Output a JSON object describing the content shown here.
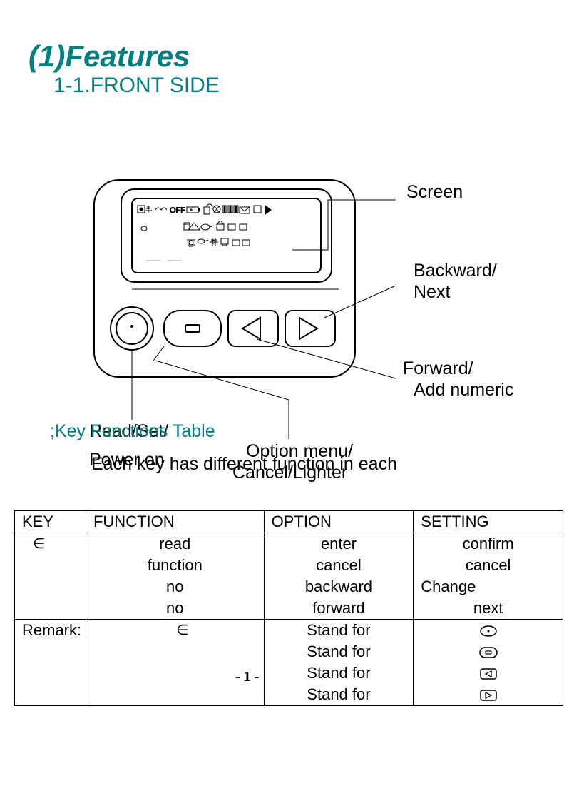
{
  "title": "(1)Features",
  "subtitle": "1-1.FRONT SIDE",
  "labels": {
    "screen": "Screen",
    "backward": "Backward/",
    "next": "Next",
    "forward": "Forward/",
    "addnumeric": "Add numeric",
    "readset": "Read/Set/",
    "poweron": "Power on",
    "optionmenu": "Option menu/",
    "cancellighter": "Cancel/Lighter"
  },
  "keyfunctions": ";Key Functions Table",
  "eachkey": "Each key has different function in each",
  "table": {
    "headers": {
      "key": "KEY",
      "function": "FUNCTION",
      "option": "OPTION",
      "setting": "SETTING"
    },
    "rows": [
      {
        "key": "∈",
        "function": "read",
        "option": "enter",
        "setting": "confirm"
      },
      {
        "key": "",
        "function": "function",
        "option": "cancel",
        "setting": "cancel"
      },
      {
        "key": "",
        "function": "no",
        "option": "backward",
        "setting": "Change"
      },
      {
        "key": "",
        "function": "no",
        "option": "forward",
        "setting": "next"
      }
    ],
    "remark_label": "Remark:",
    "remarks": [
      {
        "func": "∈",
        "option": "Stand for"
      },
      {
        "func": "",
        "option": "Stand for"
      },
      {
        "func": "",
        "option": "Stand for"
      },
      {
        "func": "",
        "option": "Stand for"
      }
    ]
  },
  "page_num": "- 1 -"
}
